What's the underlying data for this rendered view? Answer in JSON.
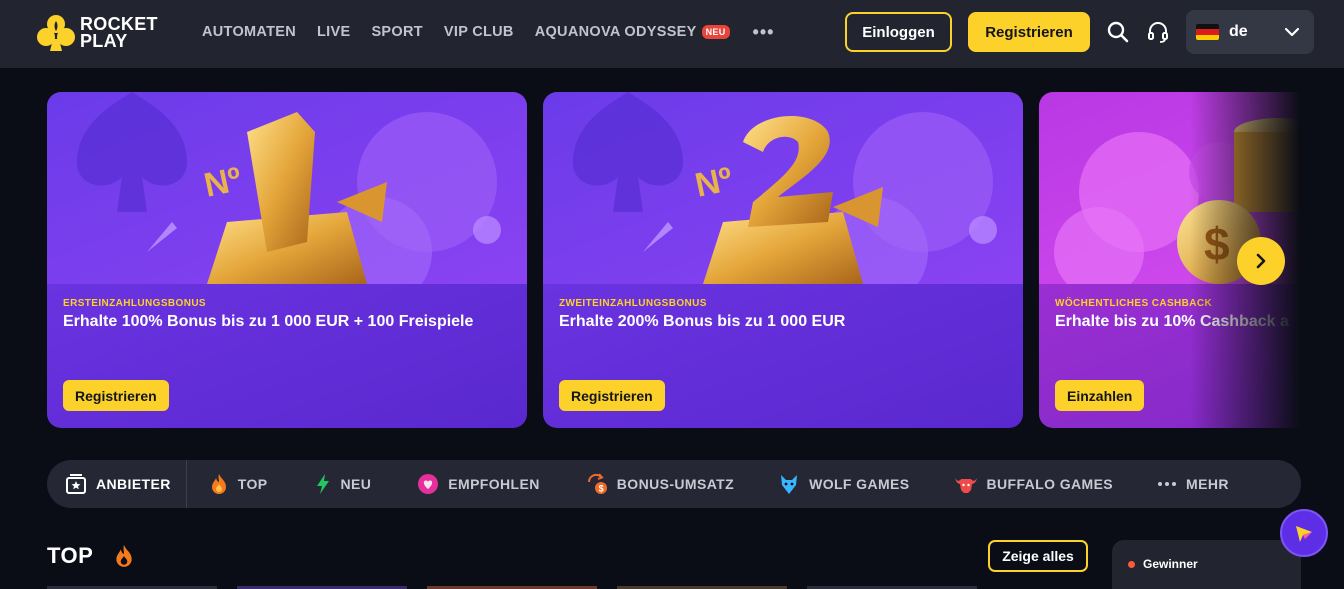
{
  "header": {
    "logo_line1": "ROCKET",
    "logo_line2": "PLAY",
    "nav": [
      {
        "label": "AUTOMATEN"
      },
      {
        "label": "LIVE"
      },
      {
        "label": "SPORT"
      },
      {
        "label": "VIP CLUB"
      },
      {
        "label": "AQUANOVA ODYSSEY",
        "badge": "NEU"
      }
    ],
    "more_label": "•••",
    "login_label": "Einloggen",
    "register_label": "Registrieren",
    "search_icon": "search-icon",
    "support_icon": "headset-icon",
    "language": "de",
    "flag": "germany-flag-icon"
  },
  "promos": [
    {
      "kicker": "ERSTEINZAHLUNGSBONUS",
      "headline": "Erhalte 100% Bonus bis zu 1 000 EUR + 100 Freispiele",
      "cta": "Registrieren",
      "art_icon": "number-one-trophy"
    },
    {
      "kicker": "ZWEITEINZAHLUNGSBONUS",
      "headline": "Erhalte 200% Bonus bis zu 1 000 EUR",
      "cta": "Registrieren",
      "art_icon": "number-two-trophy"
    },
    {
      "kicker": "WÖCHENTLICHES CASHBACK",
      "headline": "Erhalte bis zu 10% Cashback a",
      "cta": "Einzahlen",
      "art_icon": "gold-coin-stack"
    }
  ],
  "categories": [
    {
      "label": "ANBIETER",
      "icon": "provider-star-icon"
    },
    {
      "label": "TOP",
      "icon": "flame-icon"
    },
    {
      "label": "NEU",
      "icon": "lightning-icon"
    },
    {
      "label": "EMPFOHLEN",
      "icon": "heart-icon"
    },
    {
      "label": "BONUS-UMSATZ",
      "icon": "bonus-cycle-icon"
    },
    {
      "label": "WOLF GAMES",
      "icon": "wolf-icon"
    },
    {
      "label": "BUFFALO GAMES",
      "icon": "buffalo-icon"
    },
    {
      "label": "MEHR",
      "icon": "more-dots-icon"
    }
  ],
  "section": {
    "title": "TOP",
    "show_all": "Zeige alles"
  },
  "winners": {
    "label": "Gewinner"
  },
  "colors": {
    "accent": "#fcd12a",
    "header_bg": "#22242f",
    "page_bg": "#0b0d16",
    "card_purple": "#6b35e8",
    "card_magenta": "#c03be6"
  }
}
